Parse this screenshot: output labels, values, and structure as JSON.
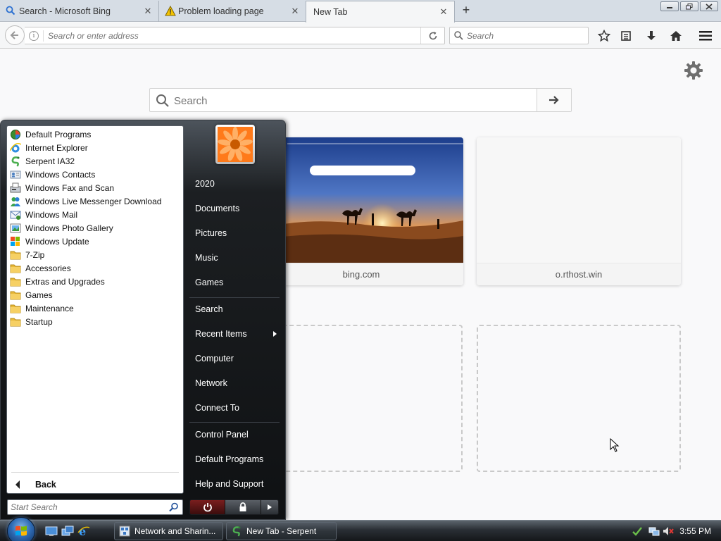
{
  "tabs": [
    {
      "title": "Search - Microsoft Bing",
      "icon": "bing-search-icon"
    },
    {
      "title": "Problem loading page",
      "icon": "warning-icon"
    },
    {
      "title": "New Tab",
      "icon": "none"
    }
  ],
  "navbar": {
    "url_placeholder": "Search or enter address",
    "search_placeholder": "Search"
  },
  "newtab": {
    "search_placeholder": "Search",
    "tiles": [
      {
        "label": "bing.com"
      },
      {
        "label": "o.rthost.win"
      }
    ]
  },
  "startmenu": {
    "programs": [
      {
        "label": "Default Programs",
        "icon": "default-programs-icon"
      },
      {
        "label": "Internet Explorer",
        "icon": "internet-explorer-icon"
      },
      {
        "label": "Serpent IA32",
        "icon": "serpent-icon"
      },
      {
        "label": "Windows Contacts",
        "icon": "contacts-icon"
      },
      {
        "label": "Windows Fax and Scan",
        "icon": "fax-icon"
      },
      {
        "label": "Windows Live Messenger Download",
        "icon": "messenger-icon"
      },
      {
        "label": "Windows Mail",
        "icon": "mail-icon"
      },
      {
        "label": "Windows Photo Gallery",
        "icon": "photo-gallery-icon"
      },
      {
        "label": "Windows Update",
        "icon": "windows-update-icon"
      },
      {
        "label": "7-Zip",
        "icon": "folder-icon"
      },
      {
        "label": "Accessories",
        "icon": "folder-icon"
      },
      {
        "label": "Extras and Upgrades",
        "icon": "folder-icon"
      },
      {
        "label": "Games",
        "icon": "folder-icon"
      },
      {
        "label": "Maintenance",
        "icon": "folder-icon"
      },
      {
        "label": "Startup",
        "icon": "folder-icon"
      }
    ],
    "back_label": "Back",
    "search_placeholder": "Start Search",
    "right_items": [
      "2020",
      "Documents",
      "Pictures",
      "Music",
      "Games",
      "Search",
      "Recent Items",
      "Computer",
      "Network",
      "Connect To",
      "Control Panel",
      "Default Programs",
      "Help and Support"
    ]
  },
  "taskbar": {
    "buttons": [
      {
        "label": "Network and Sharin...",
        "icon": "network-sharing-icon"
      },
      {
        "label": "New Tab - Serpent",
        "icon": "serpent-icon"
      }
    ],
    "clock": "3:55 PM"
  }
}
